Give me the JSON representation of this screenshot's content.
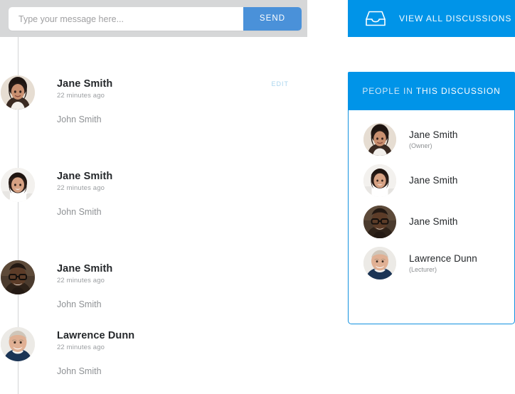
{
  "composer": {
    "placeholder": "Type your message here...",
    "value": "",
    "send_label": "SEND",
    "send_color": "#4a91d9",
    "bar_color": "#d6d7d8"
  },
  "banner": {
    "label": "VIEW ALL DISCUSSIONS",
    "icon": "inbox-icon",
    "color": "#0094e8"
  },
  "people_panel": {
    "title_dim": "PEOPLE IN",
    "title_bright": " THIS DISCUSSION",
    "header_color": "#0094e8",
    "border_color": "#1291df",
    "people": [
      {
        "name": "Jane Smith",
        "role": "(Owner)",
        "avatar": "woman-dark-hair"
      },
      {
        "name": "Jane Smith",
        "role": "",
        "avatar": "woman-smiling-cup"
      },
      {
        "name": "Jane Smith",
        "role": "",
        "avatar": "man-glasses"
      },
      {
        "name": "Lawrence Dunn",
        "role": "(Lecturer)",
        "avatar": "man-older-blond"
      }
    ]
  },
  "messages": [
    {
      "author": "Jane Smith",
      "time": "22 minutes ago",
      "text": "John Smith",
      "edit_label": "EDIT",
      "has_edit": true,
      "avatar": "woman-dark-hair"
    },
    {
      "author": "Jane Smith",
      "time": "22 minutes ago",
      "text": "John Smith",
      "edit_label": "",
      "has_edit": false,
      "avatar": "woman-smiling-cup"
    },
    {
      "author": "Jane Smith",
      "time": "22 minutes ago",
      "text": "John Smith",
      "edit_label": "",
      "has_edit": false,
      "avatar": "man-glasses"
    },
    {
      "author": "Lawrence Dunn",
      "time": "22 minutes ago",
      "text": "John Smith",
      "edit_label": "",
      "has_edit": false,
      "avatar": "man-older-blond"
    }
  ]
}
